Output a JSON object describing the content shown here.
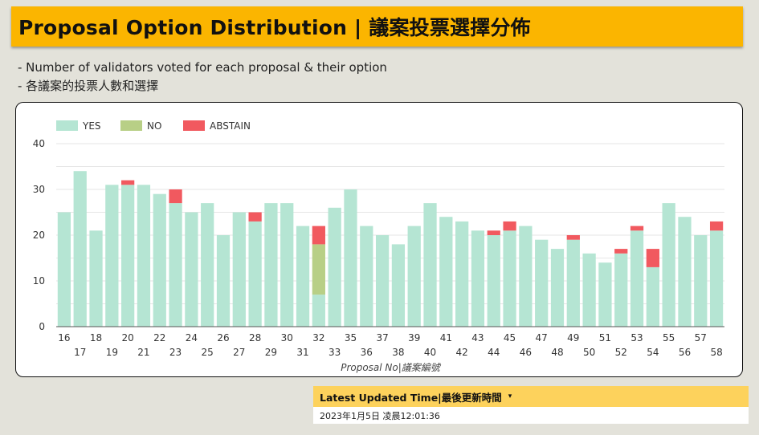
{
  "header": {
    "title": "Proposal Option Distribution | 議案投票選擇分佈"
  },
  "description": {
    "line1": "- Number of validators voted for each proposal & their option",
    "line2": "- 各議案的投票人數和選擇"
  },
  "colors": {
    "yes": "#b5e5d3",
    "no": "#b8cf86",
    "abstain": "#f1595f",
    "header_bg": "#fbb500",
    "update_bg": "#fdd25c"
  },
  "chart_data": {
    "type": "bar",
    "stacked": true,
    "xlabel": "Proposal No|議案編號",
    "ylabel": "",
    "ylim": [
      0,
      40
    ],
    "yticks": [
      0,
      10,
      20,
      30,
      40
    ],
    "grid": true,
    "legend_position": "top-left",
    "categories": [
      "16",
      "17",
      "18",
      "19",
      "20",
      "21",
      "22",
      "23",
      "24",
      "25",
      "26",
      "27",
      "28",
      "29",
      "30",
      "31",
      "32",
      "33",
      "35",
      "36",
      "37",
      "38",
      "39",
      "40",
      "41",
      "42",
      "43",
      "44",
      "45",
      "46",
      "47",
      "48",
      "49",
      "50",
      "51",
      "52",
      "53",
      "54",
      "55",
      "56",
      "57",
      "58"
    ],
    "series": [
      {
        "name": "YES",
        "color": "#b5e5d3",
        "values": [
          25,
          34,
          21,
          31,
          31,
          31,
          29,
          27,
          25,
          27,
          20,
          25,
          23,
          27,
          27,
          22,
          7,
          26,
          30,
          22,
          20,
          18,
          22,
          27,
          24,
          23,
          21,
          20,
          21,
          22,
          19,
          17,
          19,
          16,
          14,
          16,
          21,
          13,
          27,
          24,
          20,
          21
        ]
      },
      {
        "name": "NO",
        "color": "#b8cf86",
        "values": [
          0,
          0,
          0,
          0,
          0,
          0,
          0,
          0,
          0,
          0,
          0,
          0,
          0,
          0,
          0,
          0,
          11,
          0,
          0,
          0,
          0,
          0,
          0,
          0,
          0,
          0,
          0,
          0,
          0,
          0,
          0,
          0,
          0,
          0,
          0,
          0,
          0,
          0,
          0,
          0,
          0,
          0
        ]
      },
      {
        "name": "ABSTAIN",
        "color": "#f1595f",
        "values": [
          0,
          0,
          0,
          0,
          1,
          0,
          0,
          3,
          0,
          0,
          0,
          0,
          2,
          0,
          0,
          0,
          4,
          0,
          0,
          0,
          0,
          0,
          0,
          0,
          0,
          0,
          0,
          1,
          2,
          0,
          0,
          0,
          1,
          0,
          0,
          1,
          1,
          4,
          0,
          0,
          0,
          2
        ]
      }
    ]
  },
  "update": {
    "label": "Latest Updated Time|最後更新時間",
    "caret": "▾",
    "value": "2023年1月5日 凌晨12:01:36"
  }
}
